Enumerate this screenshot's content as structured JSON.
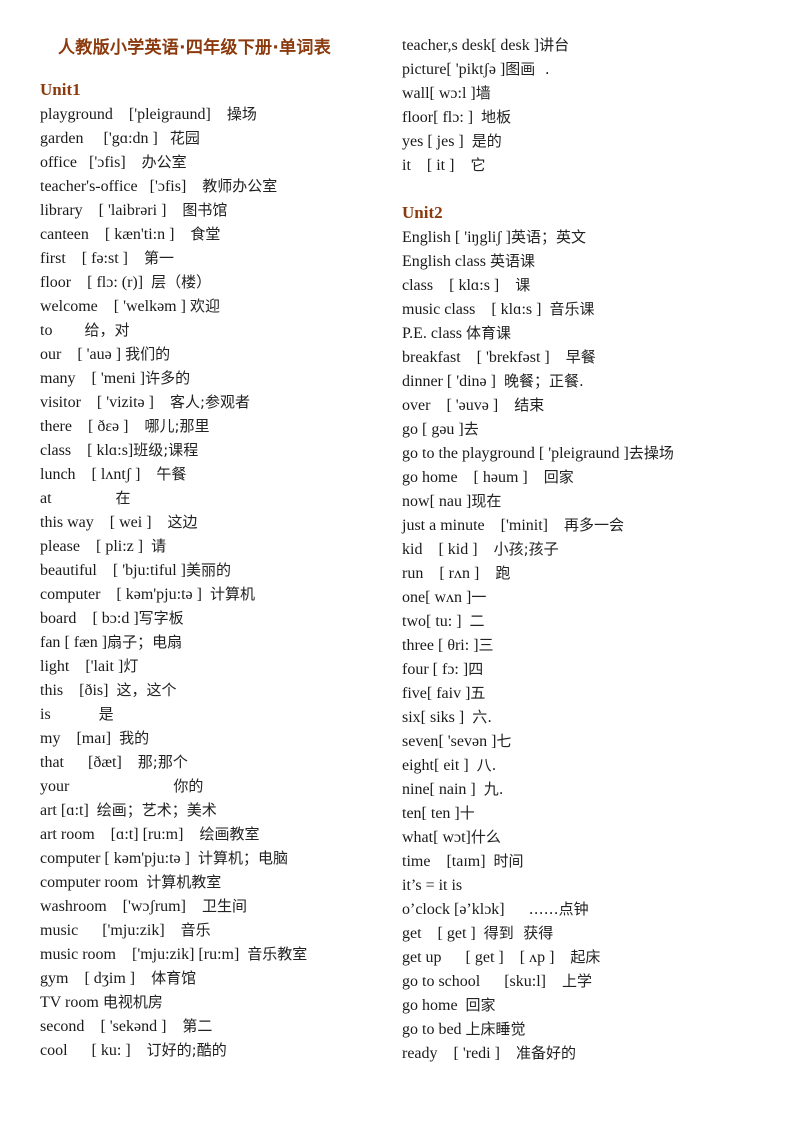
{
  "title": "人教版小学英语·四年级下册·单词表",
  "units": [
    {
      "heading": "Unit1",
      "entries": [
        {
          "word": "playground",
          "gap1": "    ",
          "phonetic": "['pleigraund]",
          "gap2": "    ",
          "meaning": "操场"
        },
        {
          "word": "garden",
          "gap1": "     ",
          "phonetic": "['gɑ:dn ]",
          "gap2": "   ",
          "meaning": "花园"
        },
        {
          "word": "office",
          "gap1": "   ",
          "phonetic": "['ɔfis]",
          "gap2": "    ",
          "meaning": "办公室"
        },
        {
          "word": "teacher's-office",
          "gap1": "   ",
          "phonetic": "['ɔfis]",
          "gap2": "    ",
          "meaning": "教师办公室"
        },
        {
          "word": "library",
          "gap1": "    ",
          "phonetic": "[ 'laibrəri ]",
          "gap2": "    ",
          "meaning": "图书馆"
        },
        {
          "word": "canteen",
          "gap1": "    ",
          "phonetic": "[ kæn'ti:n ]",
          "gap2": "    ",
          "meaning": "食堂"
        },
        {
          "word": "first",
          "gap1": "    ",
          "phonetic": "[ fə:st ]",
          "gap2": "    ",
          "meaning": "第一"
        },
        {
          "word": "floor",
          "gap1": "    ",
          "phonetic": "[ flɔ: (r)]",
          "gap2": "  ",
          "meaning": "层（楼）"
        },
        {
          "word": "welcome",
          "gap1": "    ",
          "phonetic": "[ 'welkəm ]",
          "gap2": " ",
          "meaning": "欢迎"
        },
        {
          "word": "to",
          "gap1": "        ",
          "phonetic": "",
          "gap2": "",
          "meaning": "给，对"
        },
        {
          "word": "our",
          "gap1": "    ",
          "phonetic": "[ 'auə ]",
          "gap2": " ",
          "meaning": "我们的"
        },
        {
          "word": "many",
          "gap1": "    ",
          "phonetic": "[ 'meni ]",
          "gap2": "",
          "meaning": "许多的"
        },
        {
          "word": "visitor",
          "gap1": "    ",
          "phonetic": "[ 'vizitə ]",
          "gap2": "    ",
          "meaning": "客人;参观者"
        },
        {
          "word": "there",
          "gap1": "    ",
          "phonetic": "[ ðεə ]",
          "gap2": "    ",
          "meaning": "哪儿;那里"
        },
        {
          "word": "class",
          "gap1": "    ",
          "phonetic": "[ klɑ:s]",
          "gap2": "",
          "meaning": "班级;课程"
        },
        {
          "word": "lunch",
          "gap1": "    ",
          "phonetic": "[ lʌntʃ ]",
          "gap2": "    ",
          "meaning": "午餐"
        },
        {
          "word": "at",
          "gap1": "                ",
          "phonetic": "",
          "gap2": "",
          "meaning": "在"
        },
        {
          "word": "this way",
          "gap1": "    ",
          "phonetic": "[ wei ]",
          "gap2": "    ",
          "meaning": "这边"
        },
        {
          "word": "please",
          "gap1": "    ",
          "phonetic": "[ pli:z ]",
          "gap2": "  ",
          "meaning": "请"
        },
        {
          "word": "beautiful",
          "gap1": "    ",
          "phonetic": "[ 'bju:tiful ]",
          "gap2": "",
          "meaning": "美丽的"
        },
        {
          "word": "computer",
          "gap1": "    ",
          "phonetic": "[ kəm'pju:tə ]",
          "gap2": "  ",
          "meaning": "计算机"
        },
        {
          "word": "board",
          "gap1": "    ",
          "phonetic": "[ bɔ:d ]",
          "gap2": "",
          "meaning": "写字板"
        },
        {
          "word": "fan",
          "gap1": " ",
          "phonetic": "[ fæn ]",
          "gap2": "",
          "meaning": "扇子；电扇"
        },
        {
          "word": "light",
          "gap1": "    ",
          "phonetic": "['lait ]",
          "gap2": "",
          "meaning": "灯"
        },
        {
          "word": "this",
          "gap1": "    ",
          "phonetic": "[ðis]",
          "gap2": "  ",
          "meaning": "这，这个"
        },
        {
          "word": "is",
          "gap1": "            ",
          "phonetic": "",
          "gap2": "",
          "meaning": "是"
        },
        {
          "word": "my",
          "gap1": "    ",
          "phonetic": "[maɪ]",
          "gap2": "  ",
          "meaning": "我的"
        },
        {
          "word": "that",
          "gap1": "      ",
          "phonetic": "[ðæt]",
          "gap2": "    ",
          "meaning": "那;那个"
        },
        {
          "word": "your",
          "gap1": "                          ",
          "phonetic": "",
          "gap2": "",
          "meaning": "你的"
        },
        {
          "word": "art",
          "gap1": " ",
          "phonetic": "[ɑ:t]",
          "gap2": "  ",
          "meaning": "绘画；艺术；美术"
        },
        {
          "word": "art room",
          "gap1": "    ",
          "phonetic": "[ɑ:t] [ru:m]",
          "gap2": "    ",
          "meaning": "绘画教室"
        },
        {
          "word": "computer",
          "gap1": " ",
          "phonetic": "[ kəm'pju:tə ]",
          "gap2": "  ",
          "meaning": "计算机；电脑"
        },
        {
          "word": "computer room",
          "gap1": "  ",
          "phonetic": "",
          "gap2": "",
          "meaning": "计算机教室"
        },
        {
          "word": "washroom",
          "gap1": "    ",
          "phonetic": "['wɔʃrum]",
          "gap2": "    ",
          "meaning": "卫生间"
        },
        {
          "word": "music",
          "gap1": "      ",
          "phonetic": "['mju:zik]",
          "gap2": "    ",
          "meaning": "音乐"
        },
        {
          "word": "music room",
          "gap1": "    ",
          "phonetic": "['mju:zik] [ru:m]",
          "gap2": "  ",
          "meaning": "音乐教室"
        },
        {
          "word": "gym",
          "gap1": "    ",
          "phonetic": "[ dʒim ]",
          "gap2": "    ",
          "meaning": "体育馆"
        },
        {
          "word": "TV room",
          "gap1": " ",
          "phonetic": "",
          "gap2": "",
          "meaning": "电视机房"
        },
        {
          "word": "second",
          "gap1": "    ",
          "phonetic": "[ 'sekənd ]",
          "gap2": "    ",
          "meaning": "第二"
        },
        {
          "word": "cool",
          "gap1": "      ",
          "phonetic": "[ ku: ]",
          "gap2": "    ",
          "meaning": "订好的;酷的"
        }
      ]
    },
    {
      "continuation": [
        {
          "word": "teacher,s desk",
          "gap1": "",
          "phonetic": "[ desk ]",
          "gap2": "",
          "meaning": "讲台"
        },
        {
          "word": "picture",
          "gap1": "",
          "phonetic": "[ 'piktʃə ]",
          "gap2": "",
          "meaning": "图画  ."
        },
        {
          "word": "wall",
          "gap1": "",
          "phonetic": "[ wɔ:l ]",
          "gap2": "",
          "meaning": "墙"
        },
        {
          "word": "floor",
          "gap1": "",
          "phonetic": "[ flɔ: ]",
          "gap2": "  ",
          "meaning": "地板"
        },
        {
          "word": "yes",
          "gap1": " ",
          "phonetic": "[ jes ]",
          "gap2": "  ",
          "meaning": "是的"
        },
        {
          "word": "it",
          "gap1": "    ",
          "phonetic": "[ it ]",
          "gap2": "    ",
          "meaning": "它"
        }
      ]
    },
    {
      "heading": "Unit2",
      "entries": [
        {
          "word": "English",
          "gap1": " ",
          "phonetic": "[ 'iŋgliʃ ]",
          "gap2": "",
          "meaning": "英语；英文"
        },
        {
          "word": "English class",
          "gap1": " ",
          "phonetic": "",
          "gap2": "",
          "meaning": "英语课"
        },
        {
          "word": "class",
          "gap1": "    ",
          "phonetic": "[ klɑ:s ]",
          "gap2": "    ",
          "meaning": "课"
        },
        {
          "word": "music class",
          "gap1": "    ",
          "phonetic": "[ klɑ:s ]",
          "gap2": "  ",
          "meaning": "音乐课"
        },
        {
          "word": "P.E. class",
          "gap1": " ",
          "phonetic": "",
          "gap2": "",
          "meaning": "体育课"
        },
        {
          "word": "breakfast",
          "gap1": "    ",
          "phonetic": "[ 'brekfəst ]",
          "gap2": "    ",
          "meaning": "早餐"
        },
        {
          "word": "dinner",
          "gap1": " ",
          "phonetic": "[ 'dinə ]",
          "gap2": "  ",
          "meaning": "晚餐；正餐."
        },
        {
          "word": "over",
          "gap1": "    ",
          "phonetic": "[ 'əuvə ]",
          "gap2": "    ",
          "meaning": "结束"
        },
        {
          "word": "go",
          "gap1": " ",
          "phonetic": "[ gəu ]",
          "gap2": "",
          "meaning": "去"
        },
        {
          "word": "go to the playground",
          "gap1": " ",
          "phonetic": "[ 'pleigraund ]",
          "gap2": "",
          "meaning": "去操场"
        },
        {
          "word": "go home",
          "gap1": "    ",
          "phonetic": "[ həum ]",
          "gap2": "    ",
          "meaning": "回家"
        },
        {
          "word": "now",
          "gap1": "",
          "phonetic": "[ nau ]",
          "gap2": "",
          "meaning": "现在"
        },
        {
          "word": "just a minute",
          "gap1": "    ",
          "phonetic": "['minit]",
          "gap2": "    ",
          "meaning": "再多一会"
        },
        {
          "word": "kid",
          "gap1": "    ",
          "phonetic": "[ kid ]",
          "gap2": "    ",
          "meaning": "小孩;孩子"
        },
        {
          "word": "run",
          "gap1": "    ",
          "phonetic": "[ rʌn ]",
          "gap2": "    ",
          "meaning": "跑"
        },
        {
          "word": "one",
          "gap1": "",
          "phonetic": "[ wʌn ]",
          "gap2": "",
          "meaning": "一"
        },
        {
          "word": "two",
          "gap1": "",
          "phonetic": "[ tu: ]",
          "gap2": "  ",
          "meaning": "二"
        },
        {
          "word": "three",
          "gap1": " ",
          "phonetic": "[ θri: ]",
          "gap2": "",
          "meaning": "三"
        },
        {
          "word": "four",
          "gap1": " ",
          "phonetic": "[ fɔ: ]",
          "gap2": "",
          "meaning": "四"
        },
        {
          "word": "five",
          "gap1": "",
          "phonetic": "[ faiv ]",
          "gap2": "",
          "meaning": "五"
        },
        {
          "word": "six",
          "gap1": "",
          "phonetic": "[ siks ]",
          "gap2": "  ",
          "meaning": "六."
        },
        {
          "word": "seven",
          "gap1": "",
          "phonetic": "[ 'sevən ]",
          "gap2": "",
          "meaning": "七"
        },
        {
          "word": "eight",
          "gap1": "",
          "phonetic": "[ eit ]",
          "gap2": "  ",
          "meaning": "八."
        },
        {
          "word": "nine",
          "gap1": "",
          "phonetic": "[ nain ]",
          "gap2": "  ",
          "meaning": "九."
        },
        {
          "word": "ten",
          "gap1": "",
          "phonetic": "[ ten ]",
          "gap2": "",
          "meaning": "十"
        },
        {
          "word": "what",
          "gap1": "",
          "phonetic": "[ wɔt]",
          "gap2": "",
          "meaning": "什么"
        },
        {
          "word": "time",
          "gap1": "    ",
          "phonetic": "[taɪm]",
          "gap2": "  ",
          "meaning": "时间"
        },
        {
          "word": "it’s = it is",
          "gap1": "",
          "phonetic": "",
          "gap2": "",
          "meaning": ""
        },
        {
          "word": "o’clock",
          "gap1": " ",
          "phonetic": "[ə’klɔk]",
          "gap2": "      ",
          "meaning": "……点钟"
        },
        {
          "word": "get",
          "gap1": "    ",
          "phonetic": "[ get ]",
          "gap2": "  ",
          "meaning": "得到  获得"
        },
        {
          "word": "get up",
          "gap1": "      ",
          "phonetic": "[ get ]    [ ʌp ]",
          "gap2": "    ",
          "meaning": "起床"
        },
        {
          "word": "go to school",
          "gap1": "      ",
          "phonetic": "[sku:l]",
          "gap2": "    ",
          "meaning": "上学"
        },
        {
          "word": "go home",
          "gap1": "  ",
          "phonetic": "",
          "gap2": "",
          "meaning": "回家"
        },
        {
          "word": "go to bed",
          "gap1": " ",
          "phonetic": "",
          "gap2": "",
          "meaning": "上床睡觉"
        },
        {
          "word": "ready",
          "gap1": "    ",
          "phonetic": "[ 'redi ]",
          "gap2": "    ",
          "meaning": "准备好的"
        }
      ]
    }
  ]
}
